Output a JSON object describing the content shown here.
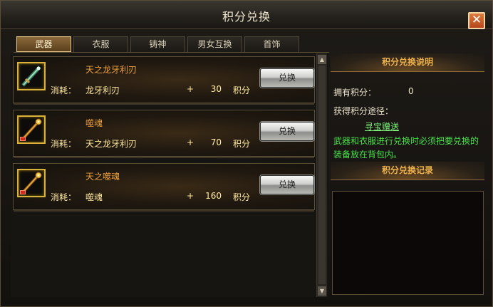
{
  "window": {
    "title": "积分兑换",
    "close_label": "✕"
  },
  "tabs": [
    {
      "label": "武器",
      "active": true
    },
    {
      "label": "衣服",
      "active": false
    },
    {
      "label": "铸神",
      "active": false
    },
    {
      "label": "男女互换",
      "active": false
    },
    {
      "label": "首饰",
      "active": false
    }
  ],
  "items": [
    {
      "name": "天之龙牙利刃",
      "cost_label": "消耗：",
      "cost_item": "龙牙利刃",
      "plus": "+",
      "points": "30",
      "unit": "积分",
      "button": "兑换",
      "icon": "dragon-blade-icon",
      "has_minus": false
    },
    {
      "name": "噬魂",
      "cost_label": "消耗：",
      "cost_item": "天之龙牙利刃",
      "plus": "+",
      "points": "70",
      "unit": "积分",
      "button": "兑换",
      "icon": "soul-staff-icon",
      "has_minus": true
    },
    {
      "name": "天之噬魂",
      "cost_label": "消耗：",
      "cost_item": "噬魂",
      "plus": "+",
      "points": "160",
      "unit": "积分",
      "button": "兑换",
      "icon": "soul-staff-icon",
      "has_minus": true
    }
  ],
  "scrollbar": {
    "up": "▲",
    "down": "▼"
  },
  "info": {
    "header": "积分兑换说明",
    "owned_label": "拥有积分：",
    "owned_value": "0",
    "ways_label": "获得积分途径：",
    "way_link": "寻宝赠送",
    "notice": "武器和衣服进行兑换时必须把要兑换的装备放在背包内。"
  },
  "records": {
    "header": "积分兑换记录"
  }
}
